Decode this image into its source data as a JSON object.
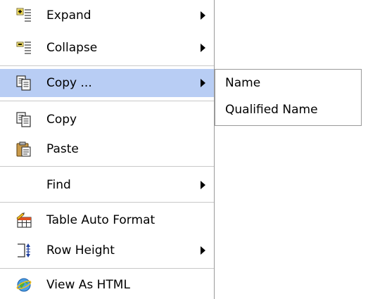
{
  "menu": {
    "items": [
      {
        "label": "Expand",
        "icon": "expand-tree-icon"
      },
      {
        "label": "Collapse",
        "icon": "collapse-tree-icon"
      },
      {
        "label": "Copy ...",
        "icon": "copy-icon",
        "highlighted": true
      },
      {
        "label": "Copy",
        "icon": "copy-icon"
      },
      {
        "label": "Paste",
        "icon": "paste-icon"
      },
      {
        "label": "Find"
      },
      {
        "label": "Table Auto Format",
        "icon": "table-autoformat-icon"
      },
      {
        "label": "Row Height",
        "icon": "row-height-icon"
      },
      {
        "label": "View As HTML",
        "icon": "browser-globe-icon"
      }
    ]
  },
  "submenu": {
    "items": [
      {
        "label": "Name"
      },
      {
        "label": "Qualified Name"
      }
    ]
  },
  "colors": {
    "highlight": "#b8cdf4",
    "border": "#9a9a9a",
    "separator": "#c8c8c8"
  }
}
